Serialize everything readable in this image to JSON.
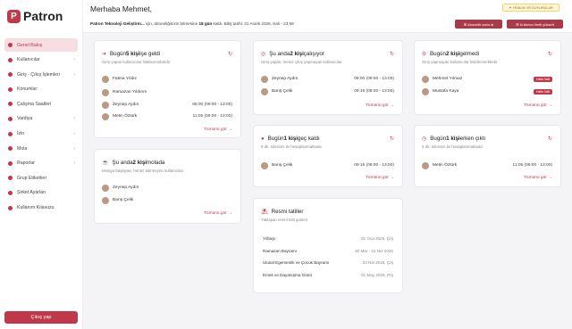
{
  "brand": {
    "name": "Patron",
    "mark": "P"
  },
  "menu": [
    {
      "label": "Genel Bakış",
      "chev": ""
    },
    {
      "label": "Kullanıcılar",
      "chev": "›"
    },
    {
      "label": "Giriş - Çıkış İşlemleri",
      "chev": "›"
    },
    {
      "label": "Konumlar",
      "chev": ""
    },
    {
      "label": "Çalışma Saatleri",
      "chev": ""
    },
    {
      "label": "Vardiya",
      "chev": "›"
    },
    {
      "label": "İzin",
      "chev": "›"
    },
    {
      "label": "Mola",
      "chev": "›"
    },
    {
      "label": "Raporlar",
      "chev": "›"
    },
    {
      "label": "Grup Etiketleri",
      "chev": ""
    },
    {
      "label": "Şirket Ayarları",
      "chev": ""
    },
    {
      "label": "Kullanım Kılavuzu",
      "chev": ""
    }
  ],
  "checkout": "Çıkış yap",
  "header": {
    "greeting": "Merhaba Mehmet,",
    "notice_company": "Patron Teknoloji Geliştirm...",
    "notice_mid": " için, aboneliğinizin bitmesine ",
    "notice_days": "18 gün",
    "notice_end": " kaldı. Bitiş tarihi: 31 Aralık 2026, Salı - 23:59",
    "btn_news": "✦ YENİLİK VE DUYURULAR",
    "btn_sub": "⊞ Abonelik satın al",
    "btn_limit": "⊞ Kullanıcı limiti yükselt"
  },
  "cards": {
    "came": {
      "t1": "Bugün ",
      "n": "5 kişi",
      "t2": " işe geldi",
      "sub": "Giriş yapan kullanıcılar listelenmektedir",
      "rows": [
        {
          "name": "Fatma Yıldız",
          "time": ""
        },
        {
          "name": "Ramazan Yıldırım",
          "time": ""
        },
        {
          "name": "Zeynep Aydın",
          "time": "08:00 (09:00 - 13:00)"
        },
        {
          "name": "Metin Öztürk",
          "time": "11:05 (09:00 - 13:00)"
        }
      ]
    },
    "working": {
      "t1": "Şu anda ",
      "n": "2 kişi",
      "t2": " çalışıyor",
      "sub": "Giriş yapan, henüz çıkış yapmayan kullanıcılar",
      "rows": [
        {
          "name": "Zeynep Aydın",
          "time": "08:00 (09:00 - 13:00)"
        },
        {
          "name": "Barış Çelik",
          "time": "09:16 (09:00 - 13:00)"
        }
      ]
    },
    "absent": {
      "t1": "Bugün ",
      "n": "2 kişi",
      "t2": " gelmedi",
      "sub": "Giriş yapmayan kullanıcılar listelenmektedir",
      "rows": [
        {
          "name": "Mehmet Yılmaz",
          "badge": "Hafta Tatili"
        },
        {
          "name": "Mustafa Kaya",
          "badge": "Hafta Tatili"
        }
      ]
    },
    "break": {
      "t1": "Şu anda ",
      "n": "2 kişi",
      "t2": " molada",
      "sub": "Molaya başlayan, henüz bitirmeyen kullanıcılar",
      "rows": [
        {
          "name": "Zeynep Aydın"
        },
        {
          "name": "Barış Çelik"
        }
      ]
    },
    "late": {
      "t1": "Bugün ",
      "n": "1 kişi",
      "t2": " geç kaldı",
      "sub": "5 dk. tolerans ile hesaplanmaktadır",
      "rows": [
        {
          "name": "Barış Çelik",
          "time": "09:16 (09:00 - 13:00)"
        }
      ]
    },
    "early": {
      "t1": "Bugün ",
      "n": "1 kişi",
      "t2": " erken çıktı",
      "sub": "5 dk. tolerans ile hesaplanmaktadır",
      "rows": [
        {
          "name": "Metin Öztürk",
          "time": "11:05 (09:00 - 13:00)"
        }
      ]
    },
    "holidays": {
      "title": "Resmi tatiller",
      "sub": "Yaklaşan resmi tatil günleri",
      "rows": [
        {
          "name": "Yılbaşı",
          "date": "01 Oca 2025, Çrş"
        },
        {
          "name": "Ramazan Bayramı",
          "date": "30 Mar - 01 Nis 2025"
        },
        {
          "name": "Ulusal Egemenlik ve Çocuk Bayramı",
          "date": "23 Nis 2025, Çrş"
        },
        {
          "name": "Emek ve Dayanışma Günü",
          "date": "01 May 2025, Prş"
        }
      ]
    }
  },
  "see_all": "Tümünü gör →",
  "colors": {
    "accent": "#c0394b",
    "active_bg": "#f7dde1"
  }
}
